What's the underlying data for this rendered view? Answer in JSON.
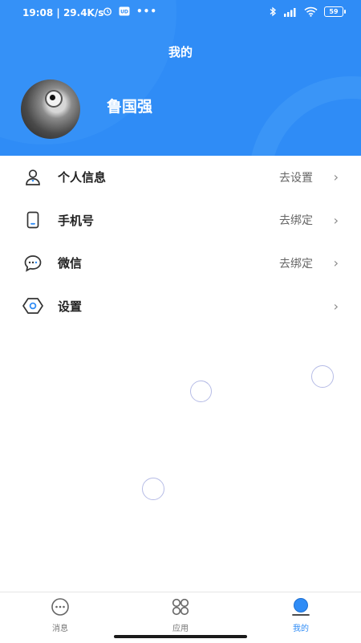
{
  "status_bar": {
    "time": "19:08",
    "speed": "29.4K/s",
    "battery": "59"
  },
  "header": {
    "title": "我的",
    "username": "鲁国强"
  },
  "menu": [
    {
      "label": "个人信息",
      "value": "去设置",
      "icon": "user-icon"
    },
    {
      "label": "手机号",
      "value": "去绑定",
      "icon": "phone-icon"
    },
    {
      "label": "微信",
      "value": "去绑定",
      "icon": "wechat-icon"
    },
    {
      "label": "设置",
      "value": "",
      "icon": "settings-icon"
    }
  ],
  "tabbar": {
    "tabs": [
      {
        "label": "消息",
        "icon": "message-icon",
        "active": false
      },
      {
        "label": "应用",
        "icon": "apps-icon",
        "active": false
      },
      {
        "label": "我的",
        "icon": "profile-icon",
        "active": true
      }
    ]
  },
  "colors": {
    "accent": "#2f8cf6",
    "header_bg": "#2f8cf6"
  }
}
